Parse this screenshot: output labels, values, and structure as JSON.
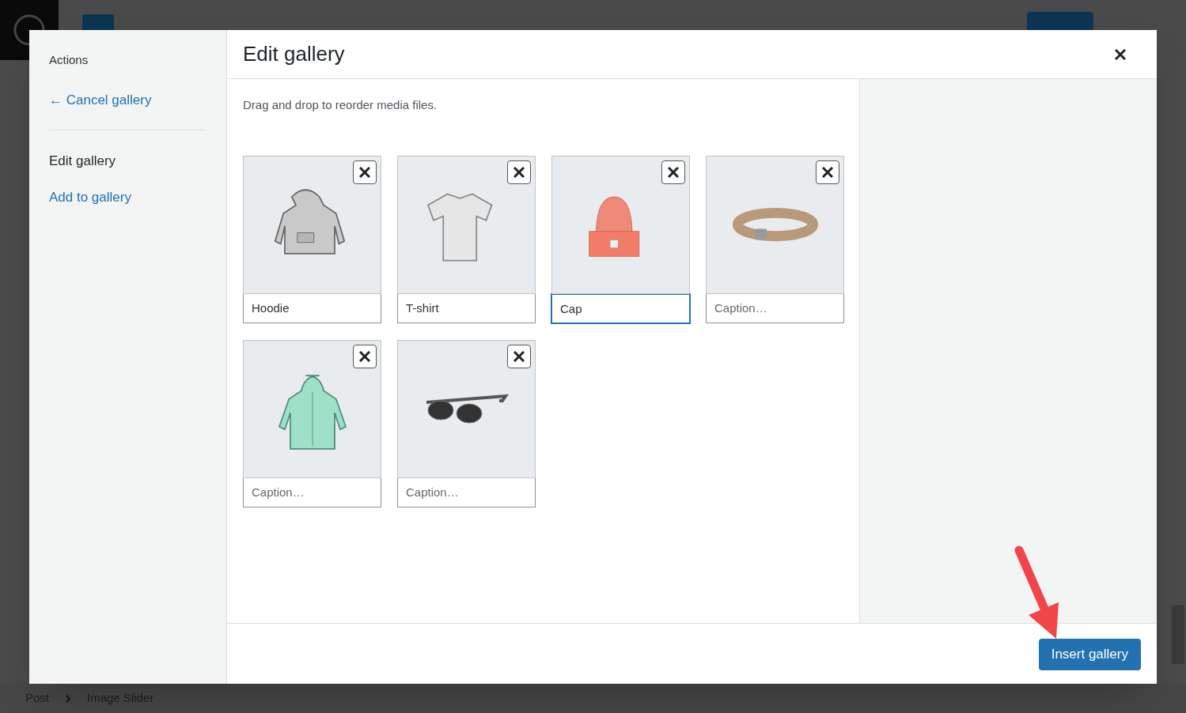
{
  "editor": {
    "breadcrumb": [
      "Post",
      "Image Slider"
    ]
  },
  "sidebar": {
    "heading": "Actions",
    "cancel_link": "← Cancel gallery",
    "items": [
      {
        "label": "Edit gallery",
        "selected": true
      },
      {
        "label": "Add to gallery",
        "selected": false
      }
    ]
  },
  "dialog": {
    "title": "Edit gallery",
    "instructions": "Drag and drop to reorder media files.",
    "items": [
      {
        "kind": "hoodie",
        "value": "Hoodie",
        "focused": false
      },
      {
        "kind": "tshirt",
        "value": "T-shirt",
        "focused": false
      },
      {
        "kind": "beanie",
        "value": "Cap",
        "focused": true
      },
      {
        "kind": "belt",
        "placeholder": "Caption…",
        "focused": false
      },
      {
        "kind": "zip-hoodie",
        "placeholder": "Caption…",
        "focused": false
      },
      {
        "kind": "sunglasses",
        "placeholder": "Caption…",
        "focused": false
      }
    ],
    "button": "Insert gallery"
  }
}
